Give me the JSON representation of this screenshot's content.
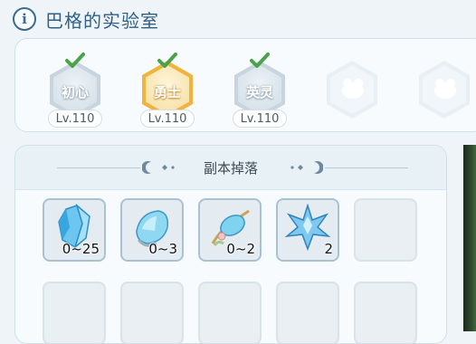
{
  "header": {
    "info_icon": "i",
    "title": "巴格的实验室"
  },
  "difficulties": [
    {
      "label": "初心",
      "level": "Lv.110",
      "completed": true,
      "active": false
    },
    {
      "label": "勇士",
      "level": "Lv.110",
      "completed": true,
      "active": true
    },
    {
      "label": "英灵",
      "level": "Lv.110",
      "completed": true,
      "active": false
    },
    {
      "label": "",
      "level": "",
      "locked": true
    },
    {
      "label": "",
      "level": "",
      "locked": true
    }
  ],
  "drops": {
    "title": "副本掉落",
    "items": [
      {
        "icon": "ice-crystal-icon",
        "quantity": "0~25"
      },
      {
        "icon": "ice-gem-icon",
        "quantity": "0~3"
      },
      {
        "icon": "ice-amulet-icon",
        "quantity": "0~2"
      },
      {
        "icon": "snowflake-icon",
        "quantity": "2"
      }
    ]
  },
  "colors": {
    "accent": "#2f5f86",
    "active_border": "#f0b43c",
    "check": "#5cb85c"
  }
}
